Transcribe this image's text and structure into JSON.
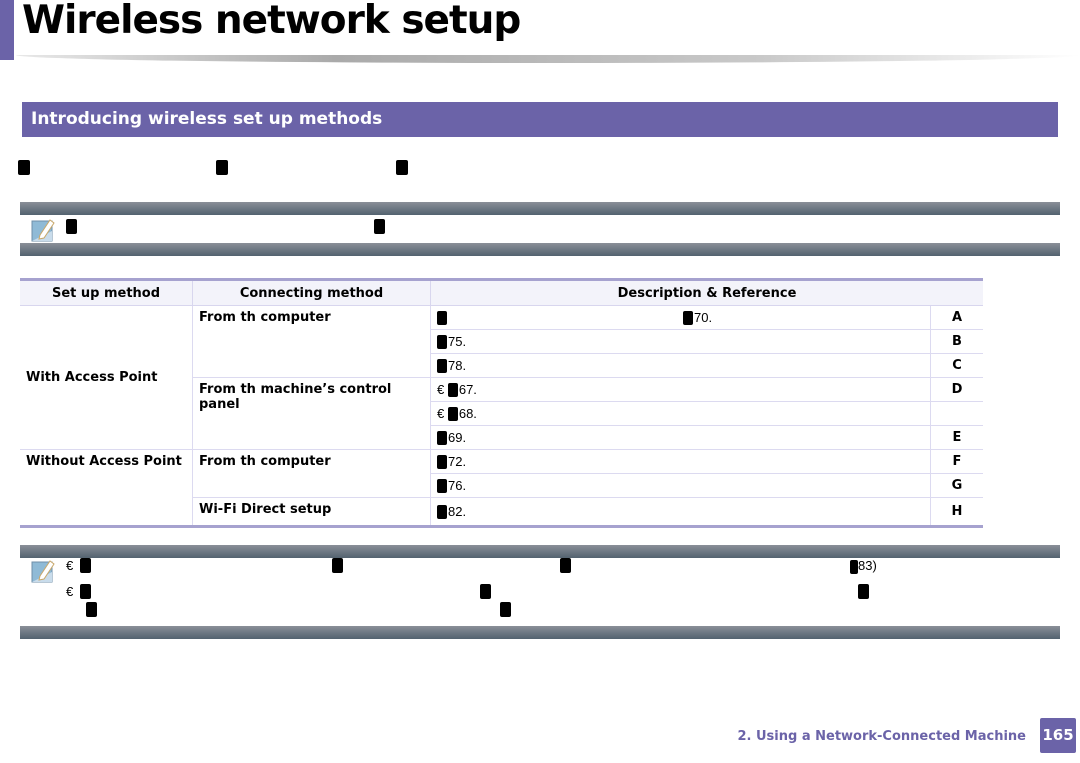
{
  "header": {
    "title": "Wireless network setup",
    "accent_color": "#6b63a8"
  },
  "section": {
    "title": "Introducing wireless set up methods"
  },
  "note_icon": "note-pencil-icon",
  "table": {
    "headers": [
      "Set up method",
      "Connecting method",
      "Description & Reference"
    ],
    "rows": [
      {
        "setup": "With Access Point",
        "connecting": "From th computer",
        "desc_suffix": "70.",
        "desc_prefix": "",
        "letter": "A"
      },
      {
        "setup": "",
        "connecting": "",
        "desc_suffix": "75.",
        "desc_prefix": "",
        "letter": "B"
      },
      {
        "setup": "",
        "connecting": "",
        "desc_suffix": "78.",
        "desc_prefix": "",
        "letter": "C"
      },
      {
        "setup": "",
        "connecting": "From th machine’s control panel",
        "desc_suffix": "67.",
        "desc_prefix": "€",
        "letter": "D"
      },
      {
        "setup": "",
        "connecting": "",
        "desc_suffix": "68.",
        "desc_prefix": "€",
        "letter": ""
      },
      {
        "setup": "",
        "connecting": "",
        "desc_suffix": "69.",
        "desc_prefix": "",
        "letter": "E"
      },
      {
        "setup": "Without Access Point",
        "connecting": "From th computer",
        "desc_suffix": "72.",
        "desc_prefix": "",
        "letter": "F"
      },
      {
        "setup": "",
        "connecting": "",
        "desc_suffix": "76.",
        "desc_prefix": "",
        "letter": "G"
      },
      {
        "setup": "",
        "connecting": "Wi-Fi Direct setup",
        "desc_suffix": "82.",
        "desc_prefix": "",
        "letter": "H"
      }
    ]
  },
  "note2": {
    "bullet": "€",
    "line1_ref": "83)"
  },
  "footer": {
    "chapter": "2.  Using a Network-Connected Machine",
    "page": "165"
  }
}
